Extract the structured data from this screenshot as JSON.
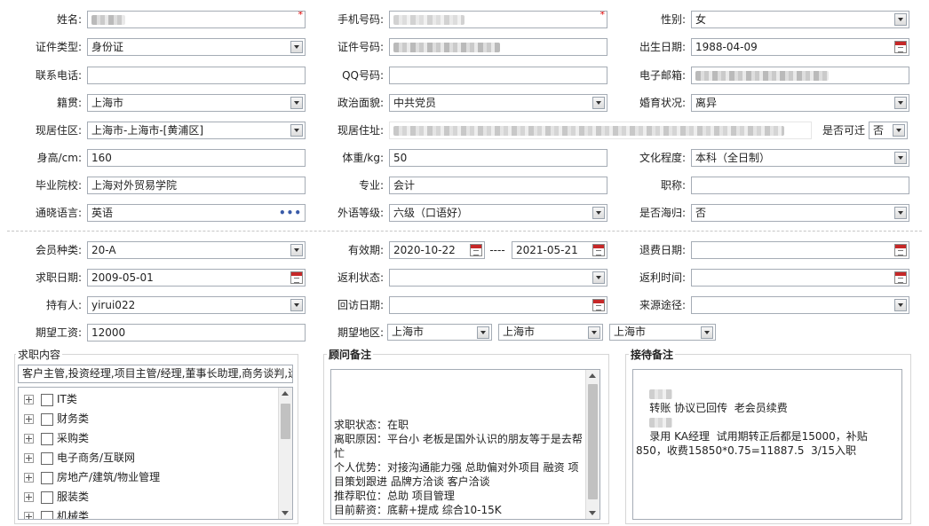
{
  "personal": {
    "name_label": "姓名:",
    "mobile_label": "手机号码:",
    "gender_label": "性别:",
    "gender_value": "女",
    "id_type_label": "证件类型:",
    "id_type_value": "身份证",
    "id_number_label": "证件号码:",
    "birth_date_label": "出生日期:",
    "birth_date_value": "1988-04-09",
    "phone_label": "联系电话:",
    "qq_label": "QQ号码:",
    "email_label": "电子邮箱:",
    "native_label": "籍贯:",
    "native_value": "上海市",
    "political_label": "政治面貌:",
    "political_value": "中共党员",
    "marital_label": "婚育状况:",
    "marital_value": "离异",
    "residence_label": "现居住区:",
    "residence_value": "上海市-上海市-[黄浦区]",
    "address_label": "现居住址:",
    "relocate_label": "是否可迁",
    "relocate_value": "否",
    "height_label": "身高/cm:",
    "height_value": "160",
    "weight_label": "体重/kg:",
    "weight_value": "50",
    "education_label": "文化程度:",
    "education_value": "本科（全日制）",
    "school_label": "毕业院校:",
    "school_value": "上海对外贸易学院",
    "major_label": "专业:",
    "major_value": "会计",
    "title_label": "职称:",
    "title_value": "",
    "language_label": "通晓语言:",
    "language_value": "英语",
    "language_level_label": "外语等级:",
    "language_level_value": "六级（口语好）",
    "overseas_label": "是否海归:",
    "overseas_value": "否"
  },
  "membership": {
    "member_type_label": "会员种类:",
    "member_type_value": "20-A",
    "valid_label": "有效期:",
    "valid_start": "2020-10-22",
    "valid_sep": "----",
    "valid_end": "2021-05-21",
    "refund_date_label": "退费日期:",
    "job_date_label": "求职日期:",
    "job_date_value": "2009-05-01",
    "rebate_status_label": "返利状态:",
    "rebate_time_label": "返利时间:",
    "holder_label": "持有人:",
    "holder_value": "yirui022",
    "visit_date_label": "回访日期:",
    "source_label": "来源途径:",
    "salary_label": "期望工资:",
    "salary_value": "12000",
    "area_label": "期望地区:",
    "area_values": [
      "上海市",
      "上海市",
      "上海市"
    ]
  },
  "job_intent": {
    "title": "求职内容",
    "summary": "客户主管,投资经理,项目主管/经理,董事长助理,商务谈判,运",
    "tree_items": [
      "IT类",
      "财务类",
      "采购类",
      "电子商务/互联网",
      "房地产/建筑/物业管理",
      "服装类",
      "机械类"
    ]
  },
  "consultant_notes": {
    "title": "顾问备注",
    "text": "求职状态：在职\n离职原因：平台小 老板是国外认识的朋友等于是去帮忙\n个人优势：对接沟通能力强 总助偏对外项目 融资 项目策划跟进 品牌方洽谈 客户洽谈\n推荐职位：总助 项目管理\n目前薪资：底薪+提成 综合10-15K"
  },
  "reception_notes": {
    "title": "接待备注",
    "line1": "转账 协议已回传  老会员续费",
    "line2": "录用 KA经理  试用期转正后都是15000，补贴850，收费15850*0.75=11887.5  3/15入职"
  },
  "colors": {
    "required": "#e00000",
    "dots": "#3a5ba8",
    "calendar": "#c62828"
  }
}
